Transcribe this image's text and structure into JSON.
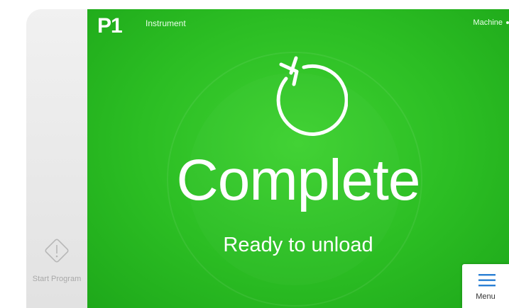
{
  "sidebar": {
    "start_program": {
      "icon": "start-program-diamond-icon",
      "label": "Start Program"
    }
  },
  "header": {
    "instrument_id": "P1",
    "instrument_label": "Instrument",
    "machine_label": "Machine"
  },
  "status": {
    "icon": "cycle-complete-icon",
    "title": "Complete",
    "subtitle": "Ready to unload"
  },
  "menu": {
    "icon": "hamburger-menu-icon",
    "label": "Menu"
  },
  "colors": {
    "screen_green": "#2bbd23",
    "sidebar_gray": "#ececec",
    "menu_icon_blue": "#2a7fd4",
    "text_white": "#ffffff"
  }
}
